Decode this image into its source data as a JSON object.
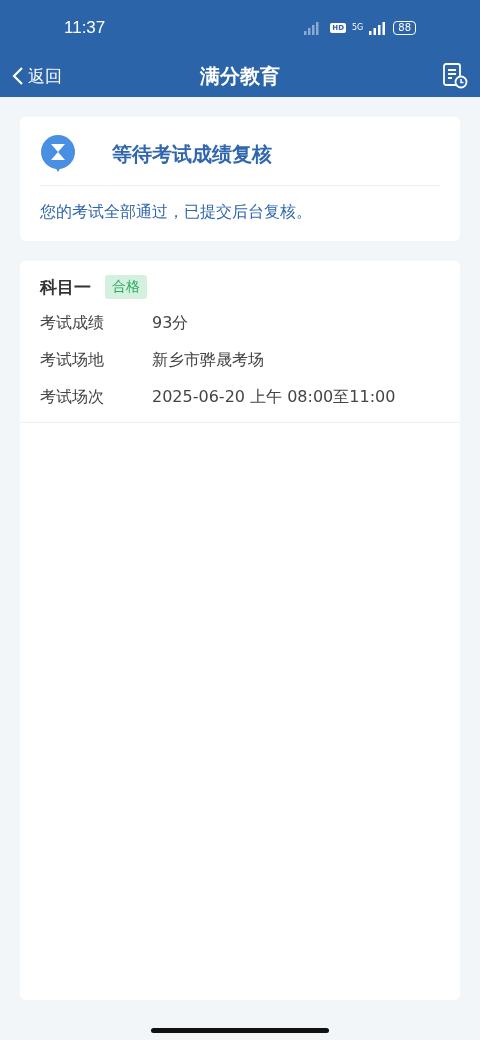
{
  "status_bar": {
    "time": "11:37",
    "hd": "HD",
    "network": "5G",
    "battery": "88"
  },
  "nav": {
    "back": "返回",
    "title": "满分教育"
  },
  "notice": {
    "title": "等待考试成绩复核",
    "message": "您的考试全部通过，已提交后台复核。"
  },
  "subjects": [
    {
      "name": "科目一",
      "tag": "合格",
      "fields": [
        {
          "label": "考试成绩",
          "value": "93分"
        },
        {
          "label": "考试场地",
          "value": "新乡市骅晟考场"
        },
        {
          "label": "考试场次",
          "value": "2025-06-20 上午 08:00至11:00"
        }
      ]
    }
  ]
}
